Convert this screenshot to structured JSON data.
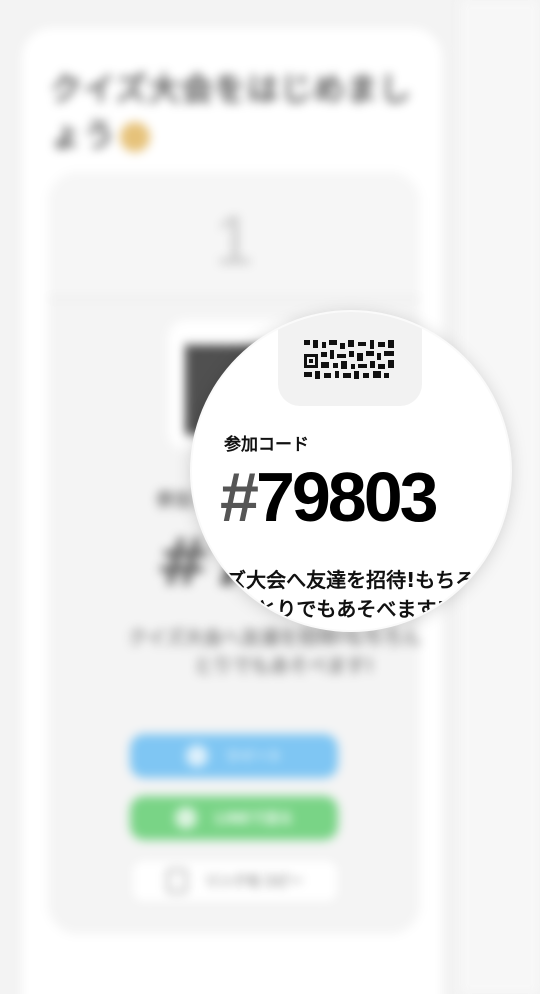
{
  "page": {
    "title": "クイズ大会をはじめましょう",
    "step_number": "1"
  },
  "invite": {
    "code_label": "参加コード",
    "code_hash": "#",
    "code_number": "79803",
    "description": "クイズ大会へ友達を招待!もちろんひとりでもあそべます!"
  },
  "actions": {
    "tweet_label": "ツイート",
    "line_label": "LINEで送る",
    "copy_label": "リンクをコピー"
  },
  "colors": {
    "twitter": "#7fc6f3",
    "line": "#79d486",
    "background": "#f3f3f3"
  },
  "icons": [
    "smile-emoji-icon",
    "qr-code-icon",
    "twitter-bird-icon",
    "line-chat-icon",
    "clipboard-icon"
  ]
}
